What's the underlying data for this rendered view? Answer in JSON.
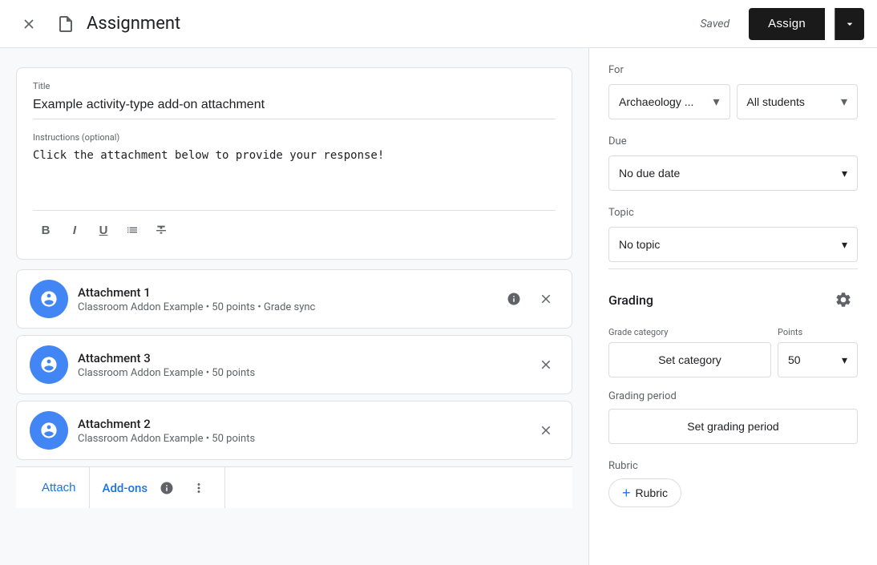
{
  "header": {
    "title": "Assignment",
    "saved_label": "Saved",
    "assign_label": "Assign"
  },
  "form": {
    "title_label": "Title",
    "title_value": "Example activity-type add-on attachment",
    "instructions_label": "Instructions (optional)",
    "instructions_value": "Click the attachment below to provide your response!"
  },
  "attachments": [
    {
      "name": "Attachment 1",
      "meta": "Classroom Addon Example • 50 points • Grade sync"
    },
    {
      "name": "Attachment 3",
      "meta": "Classroom Addon Example • 50 points"
    },
    {
      "name": "Attachment 2",
      "meta": "Classroom Addon Example • 50 points"
    }
  ],
  "bottom_bar": {
    "attach_label": "Attach",
    "addons_label": "Add-ons"
  },
  "right": {
    "for_label": "For",
    "class_value": "Archaeology ...",
    "students_value": "All students",
    "due_label": "Due",
    "due_value": "No due date",
    "topic_label": "Topic",
    "topic_value": "No topic",
    "grading_title": "Grading",
    "grade_category_label": "Grade category",
    "points_label": "Points",
    "set_category_label": "Set category",
    "points_value": "50",
    "grading_period_label": "Grading period",
    "set_grading_period_label": "Set grading period",
    "rubric_label": "Rubric",
    "add_rubric_label": "Rubric"
  }
}
